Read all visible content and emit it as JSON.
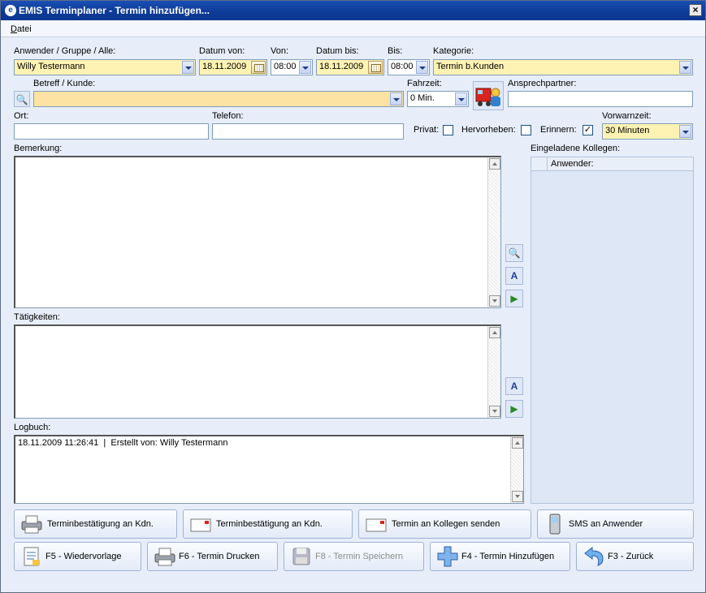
{
  "window": {
    "title": "EMIS Terminplaner - Termin hinzufügen...",
    "close": "×"
  },
  "menu": {
    "items": [
      "Datei"
    ]
  },
  "labels": {
    "user": "Anwender / Gruppe / Alle:",
    "date_from": "Datum von:",
    "time_from": "Von:",
    "date_to": "Datum bis:",
    "time_to": "Bis:",
    "category": "Kategorie:",
    "subject": "Betreff / Kunde:",
    "travel": "Fahrzeit:",
    "contact": "Ansprechpartner:",
    "location": "Ort:",
    "phone": "Telefon:",
    "private": "Privat:",
    "highlight": "Hervorheben:",
    "remind": "Erinnern:",
    "lead": "Vorwarnzeit:",
    "remark": "Bemerkung:",
    "activities": "Tätigkeiten:",
    "log": "Logbuch:",
    "invited": "Eingeladene Kollegen:"
  },
  "fields": {
    "user": "Willy Testermann",
    "date_from": "18.11.2009",
    "time_from": "08:00",
    "date_to": "18.11.2009",
    "time_to": "08:00",
    "category": "Termin b.Kunden",
    "subject": "",
    "travel": "0 Min.",
    "contact": "",
    "location": "",
    "phone": "",
    "lead": "30 Minuten",
    "private": false,
    "highlight": false,
    "remind": true
  },
  "log_entries": [
    "18.11.2009 11:26:41  |  Erstellt von: Willy Testermann"
  ],
  "invited_table": {
    "columns": [
      "Anwender:"
    ]
  },
  "buttons": {
    "row1": [
      {
        "label": "Terminbestätigung an Kdn.",
        "icon": "printer-icon"
      },
      {
        "label": "Terminbestätigung an Kdn.",
        "icon": "letter-icon"
      },
      {
        "label": "Termin an Kollegen senden",
        "icon": "letter-icon"
      },
      {
        "label": "SMS an Anwender",
        "icon": "mobile-phone-icon"
      }
    ],
    "row2": [
      {
        "label": "F5 - Wiedervorlage",
        "icon": "calendar-note-icon"
      },
      {
        "label": "F6 - Termin Drucken",
        "icon": "printer-icon"
      },
      {
        "label": "F8 - Termin Speichern",
        "icon": "save-disk-icon",
        "disabled": true
      },
      {
        "label": "F4 - Termin Hinzufügen",
        "icon": "add-plus-icon"
      },
      {
        "label": "F3 - Zurück",
        "icon": "back-arrow-icon"
      }
    ]
  },
  "colors": {
    "titlebar": "#0c3a96",
    "window_bg": "#e7eef9",
    "field_yellow": "#fff3b3"
  }
}
